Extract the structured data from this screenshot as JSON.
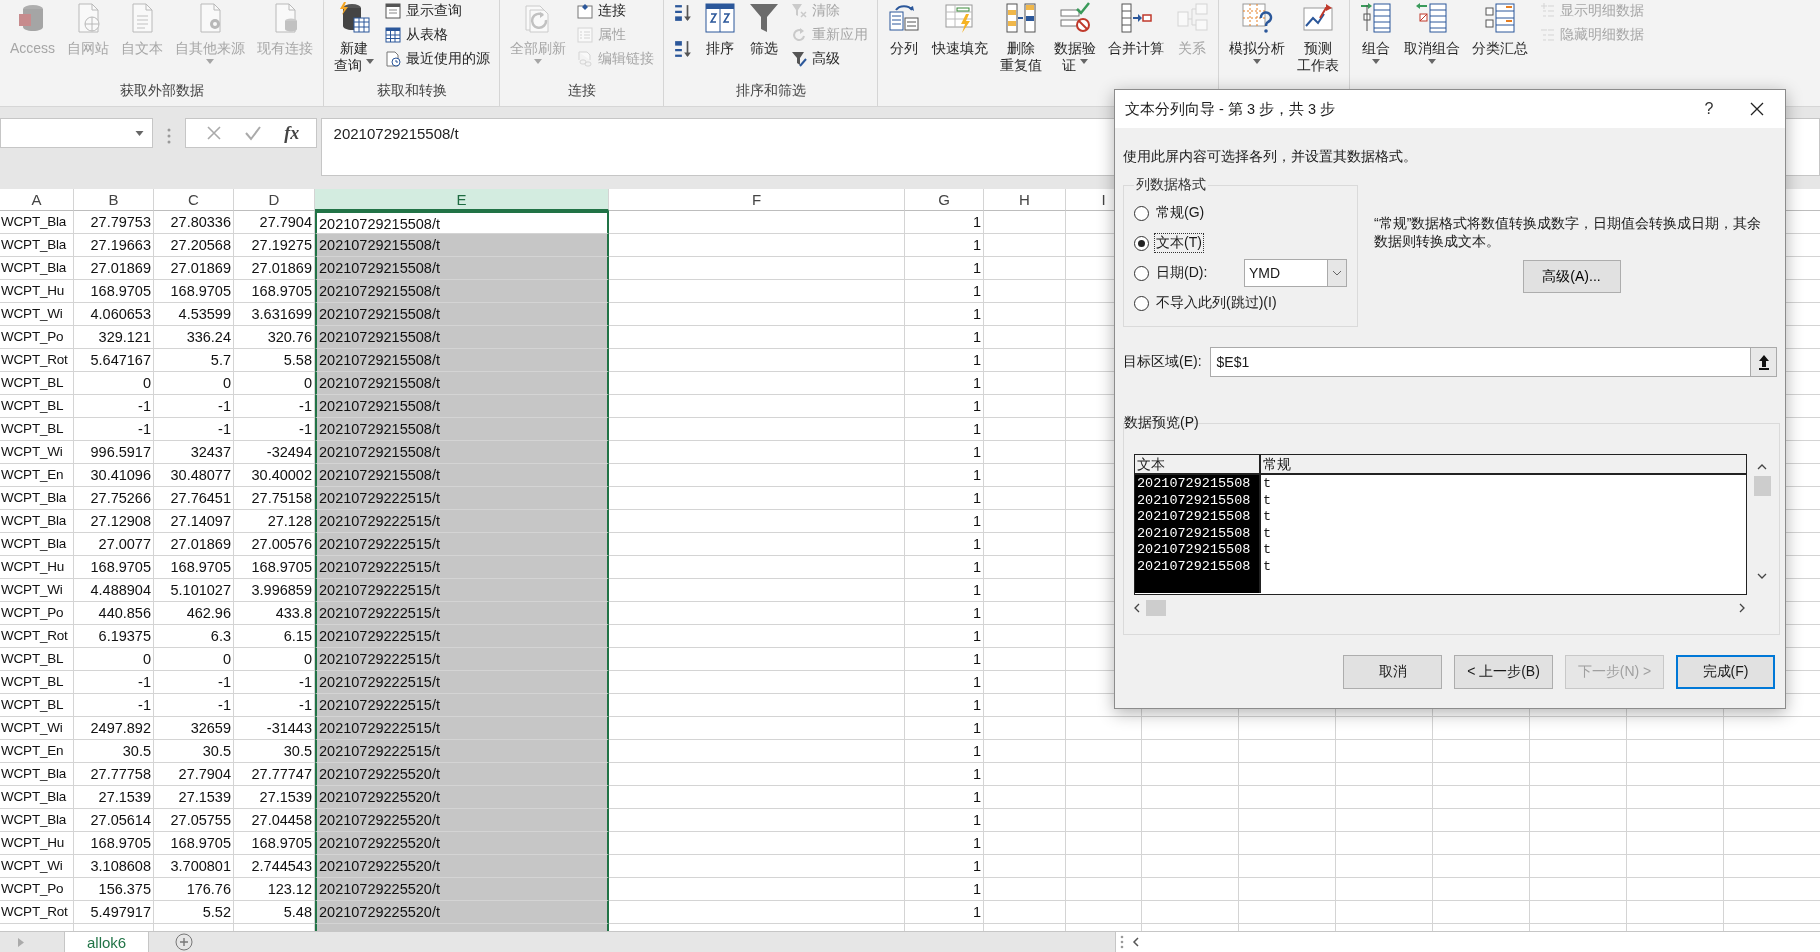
{
  "ribbon": {
    "groups": [
      {
        "label": "获取外部数据",
        "items": [
          {
            "kind": "big",
            "lines": [
              "Access"
            ],
            "disabled": true,
            "menu": false
          },
          {
            "kind": "big",
            "lines": [
              "自网站"
            ],
            "disabled": true,
            "menu": false
          },
          {
            "kind": "big",
            "lines": [
              "自文本"
            ],
            "disabled": true,
            "menu": false
          },
          {
            "kind": "big",
            "lines": [
              "自其他来源"
            ],
            "disabled": true,
            "menu": true
          },
          {
            "kind": "big",
            "lines": [
              "现有连接"
            ],
            "disabled": true,
            "menu": false
          }
        ]
      },
      {
        "label": "获取和转换",
        "items": [
          {
            "kind": "big",
            "lines": [
              "新建",
              "查询"
            ],
            "disabled": false,
            "menu": true
          },
          {
            "kind": "small",
            "lines": [
              "显示查询"
            ],
            "disabled": false,
            "menu": false
          },
          {
            "kind": "small",
            "lines": [
              "从表格"
            ],
            "disabled": false,
            "menu": false
          },
          {
            "kind": "small",
            "lines": [
              "最近使用的源"
            ],
            "disabled": false,
            "menu": false
          }
        ]
      },
      {
        "label": "连接",
        "items": [
          {
            "kind": "big",
            "lines": [
              "全部刷新"
            ],
            "disabled": true,
            "menu": true
          },
          {
            "kind": "small",
            "lines": [
              "连接"
            ],
            "disabled": false,
            "menu": false
          },
          {
            "kind": "small",
            "lines": [
              "属性"
            ],
            "disabled": true,
            "menu": false
          },
          {
            "kind": "small",
            "lines": [
              "编辑链接"
            ],
            "disabled": true,
            "menu": false
          }
        ]
      },
      {
        "label": "排序和筛选",
        "items": [
          {
            "kind": "icon",
            "disabled": false,
            "menu": false
          },
          {
            "kind": "icon",
            "disabled": false,
            "menu": false
          },
          {
            "kind": "big",
            "lines": [
              "排序"
            ],
            "disabled": false,
            "menu": false
          },
          {
            "kind": "big",
            "lines": [
              "筛选"
            ],
            "disabled": false,
            "menu": false
          },
          {
            "kind": "small",
            "lines": [
              "清除"
            ],
            "disabled": true,
            "menu": false
          },
          {
            "kind": "small",
            "lines": [
              "重新应用"
            ],
            "disabled": true,
            "menu": false
          },
          {
            "kind": "small",
            "lines": [
              "高级"
            ],
            "disabled": false,
            "menu": false
          }
        ]
      },
      {
        "items": [
          {
            "kind": "big",
            "lines": [
              "分列"
            ],
            "disabled": false,
            "menu": false
          },
          {
            "kind": "big",
            "lines": [
              "快速填充"
            ],
            "disabled": false,
            "menu": false
          },
          {
            "kind": "big",
            "lines": [
              "删除",
              "重复值"
            ],
            "disabled": false,
            "menu": false
          },
          {
            "kind": "big",
            "lines": [
              "数据验",
              "证"
            ],
            "disabled": false,
            "menu": true
          },
          {
            "kind": "big",
            "lines": [
              "合并计算"
            ],
            "disabled": false,
            "menu": false
          },
          {
            "kind": "big",
            "lines": [
              "关系"
            ],
            "disabled": true,
            "menu": false
          }
        ]
      },
      {
        "items": [
          {
            "kind": "big",
            "lines": [
              "模拟分析"
            ],
            "disabled": false,
            "menu": true
          },
          {
            "kind": "big",
            "lines": [
              "预测",
              "工作表"
            ],
            "disabled": false,
            "menu": false
          }
        ]
      },
      {
        "items": [
          {
            "kind": "big",
            "lines": [
              "组合"
            ],
            "disabled": false,
            "menu": true
          },
          {
            "kind": "big",
            "lines": [
              "取消组合"
            ],
            "disabled": false,
            "menu": true
          },
          {
            "kind": "big",
            "lines": [
              "分类汇总"
            ],
            "disabled": false,
            "menu": false
          },
          {
            "kind": "small",
            "lines": [
              "显示明细数据"
            ],
            "disabled": true,
            "menu": false
          },
          {
            "kind": "small",
            "lines": [
              "隐藏明细数据"
            ],
            "disabled": true,
            "menu": false
          }
        ]
      }
    ]
  },
  "formula_bar": {
    "function_label": "fx",
    "value": "20210729215508/t"
  },
  "sheet": {
    "columns": [
      {
        "label": "A",
        "selected": false
      },
      {
        "label": "B",
        "selected": false
      },
      {
        "label": "C",
        "selected": false
      },
      {
        "label": "D",
        "selected": false
      },
      {
        "label": "E",
        "selected": true
      },
      {
        "label": "F",
        "selected": false
      },
      {
        "label": "G",
        "selected": false
      },
      {
        "label": "H",
        "selected": false
      },
      {
        "label": "I",
        "selected": false
      }
    ],
    "rows": [
      {
        "a": "WCPT_Bla",
        "b": "27.79753",
        "c": "27.80336",
        "d": "27.7904",
        "e": "20210729215508/t",
        "g": "1",
        "active": true
      },
      {
        "a": "WCPT_Bla",
        "b": "27.19663",
        "c": "27.20568",
        "d": "27.19275",
        "e": "20210729215508/t",
        "g": "1",
        "active": false
      },
      {
        "a": "WCPT_Bla",
        "b": "27.01869",
        "c": "27.01869",
        "d": "27.01869",
        "e": "20210729215508/t",
        "g": "1",
        "active": false
      },
      {
        "a": "WCPT_Hu",
        "b": "168.9705",
        "c": "168.9705",
        "d": "168.9705",
        "e": "20210729215508/t",
        "g": "1",
        "active": false
      },
      {
        "a": "WCPT_Wi",
        "b": "4.060653",
        "c": "4.53599",
        "d": "3.631699",
        "e": "20210729215508/t",
        "g": "1",
        "active": false
      },
      {
        "a": "WCPT_Po",
        "b": "329.121",
        "c": "336.24",
        "d": "320.76",
        "e": "20210729215508/t",
        "g": "1",
        "active": false
      },
      {
        "a": "WCPT_Rot",
        "b": "5.647167",
        "c": "5.7",
        "d": "5.58",
        "e": "20210729215508/t",
        "g": "1",
        "active": false
      },
      {
        "a": "WCPT_BL",
        "b": "0",
        "c": "0",
        "d": "0",
        "e": "20210729215508/t",
        "g": "1",
        "active": false
      },
      {
        "a": "WCPT_BL",
        "b": "-1",
        "c": "-1",
        "d": "-1",
        "e": "20210729215508/t",
        "g": "1",
        "active": false
      },
      {
        "a": "WCPT_BL",
        "b": "-1",
        "c": "-1",
        "d": "-1",
        "e": "20210729215508/t",
        "g": "1",
        "active": false
      },
      {
        "a": "WCPT_Wi",
        "b": "996.5917",
        "c": "32437",
        "d": "-32494",
        "e": "20210729215508/t",
        "g": "1",
        "active": false
      },
      {
        "a": "WCPT_En",
        "b": "30.41096",
        "c": "30.48077",
        "d": "30.40002",
        "e": "20210729215508/t",
        "g": "1",
        "active": false
      },
      {
        "a": "WCPT_Bla",
        "b": "27.75266",
        "c": "27.76451",
        "d": "27.75158",
        "e": "20210729222515/t",
        "g": "1",
        "active": false
      },
      {
        "a": "WCPT_Bla",
        "b": "27.12908",
        "c": "27.14097",
        "d": "27.128",
        "e": "20210729222515/t",
        "g": "1",
        "active": false
      },
      {
        "a": "WCPT_Bla",
        "b": "27.0077",
        "c": "27.01869",
        "d": "27.00576",
        "e": "20210729222515/t",
        "g": "1",
        "active": false
      },
      {
        "a": "WCPT_Hu",
        "b": "168.9705",
        "c": "168.9705",
        "d": "168.9705",
        "e": "20210729222515/t",
        "g": "1",
        "active": false
      },
      {
        "a": "WCPT_Wi",
        "b": "4.488904",
        "c": "5.101027",
        "d": "3.996859",
        "e": "20210729222515/t",
        "g": "1",
        "active": false
      },
      {
        "a": "WCPT_Po",
        "b": "440.856",
        "c": "462.96",
        "d": "433.8",
        "e": "20210729222515/t",
        "g": "1",
        "active": false
      },
      {
        "a": "WCPT_Rot",
        "b": "6.19375",
        "c": "6.3",
        "d": "6.15",
        "e": "20210729222515/t",
        "g": "1",
        "active": false
      },
      {
        "a": "WCPT_BL",
        "b": "0",
        "c": "0",
        "d": "0",
        "e": "20210729222515/t",
        "g": "1",
        "active": false
      },
      {
        "a": "WCPT_BL",
        "b": "-1",
        "c": "-1",
        "d": "-1",
        "e": "20210729222515/t",
        "g": "1",
        "active": false
      },
      {
        "a": "WCPT_BL",
        "b": "-1",
        "c": "-1",
        "d": "-1",
        "e": "20210729222515/t",
        "g": "1",
        "active": false
      },
      {
        "a": "WCPT_Wi",
        "b": "2497.892",
        "c": "32659",
        "d": "-31443",
        "e": "20210729222515/t",
        "g": "1",
        "active": false
      },
      {
        "a": "WCPT_En",
        "b": "30.5",
        "c": "30.5",
        "d": "30.5",
        "e": "20210729222515/t",
        "g": "1",
        "active": false
      },
      {
        "a": "WCPT_Bla",
        "b": "27.77758",
        "c": "27.7904",
        "d": "27.77747",
        "e": "20210729225520/t",
        "g": "1",
        "active": false
      },
      {
        "a": "WCPT_Bla",
        "b": "27.1539",
        "c": "27.1539",
        "d": "27.1539",
        "e": "20210729225520/t",
        "g": "1",
        "active": false
      },
      {
        "a": "WCPT_Bla",
        "b": "27.05614",
        "c": "27.05755",
        "d": "27.04458",
        "e": "20210729225520/t",
        "g": "1",
        "active": false
      },
      {
        "a": "WCPT_Hu",
        "b": "168.9705",
        "c": "168.9705",
        "d": "168.9705",
        "e": "20210729225520/t",
        "g": "1",
        "active": false
      },
      {
        "a": "WCPT_Wi",
        "b": "3.108608",
        "c": "3.700801",
        "d": "2.744543",
        "e": "20210729225520/t",
        "g": "1",
        "active": false
      },
      {
        "a": "WCPT_Po",
        "b": "156.375",
        "c": "176.76",
        "d": "123.12",
        "e": "20210729225520/t",
        "g": "1",
        "active": false
      },
      {
        "a": "WCPT_Rot",
        "b": "5.497917",
        "c": "5.52",
        "d": "5.48",
        "e": "20210729225520/t",
        "g": "1",
        "active": false
      }
    ]
  },
  "sheet_tabs": [
    {
      "label": "allok6",
      "selected": true
    }
  ],
  "dialog": {
    "title": "文本分列向导 - 第 3 步，共 3 步",
    "help": "?",
    "instruction": "使用此屏内容可选择各列，并设置其数据格式。",
    "format_group": {
      "legend": "列数据格式",
      "options": [
        {
          "label": "常规(G)",
          "selected": false
        },
        {
          "label": "文本(T)",
          "selected": true
        },
        {
          "label": "日期(D):",
          "selected": false,
          "value": "YMD"
        },
        {
          "label": "不导入此列(跳过)(I)",
          "selected": false
        }
      ]
    },
    "note": "“常规”数据格式将数值转换成数字，日期值会转换成日期，其余数据则转换成文本。",
    "advanced_button": "高级(A)...",
    "destination": {
      "label": "目标区域(E):",
      "value": "$E$1"
    },
    "preview": {
      "legend": "数据预览(P)",
      "columns": [
        {
          "header": "文本",
          "selected": true
        },
        {
          "header": "常规",
          "selected": false
        }
      ],
      "rows": [
        [
          "20210729215508",
          "t"
        ],
        [
          "20210729215508",
          "t"
        ],
        [
          "20210729215508",
          "t"
        ],
        [
          "20210729215508",
          "t"
        ],
        [
          "20210729215508",
          "t"
        ],
        [
          "20210729215508",
          "t"
        ]
      ]
    },
    "buttons": [
      {
        "label": "取消",
        "disabled": false,
        "default": false
      },
      {
        "label": "< 上一步(B)",
        "disabled": false,
        "default": false
      },
      {
        "label": "下一步(N) >",
        "disabled": true,
        "default": false
      },
      {
        "label": "完成(F)",
        "disabled": false,
        "default": true
      }
    ]
  }
}
